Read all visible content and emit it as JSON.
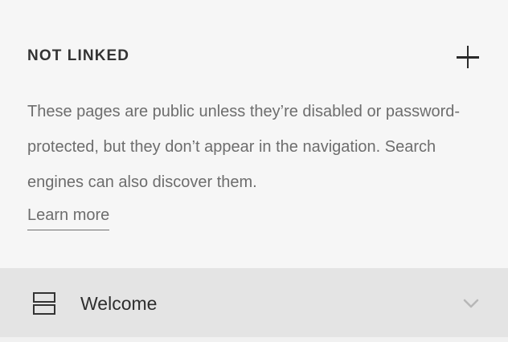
{
  "section": {
    "title": "NOT LINKED",
    "add_icon": "plus-icon",
    "description": "These pages are public unless they’re disabled or password-protected, but they don’t appear in the navigation. Search engines can also discover them.",
    "learn_more_label": "Learn more"
  },
  "pages": [
    {
      "title": "Welcome",
      "icon": "layout-page-icon",
      "expand_icon": "chevron-down-icon"
    }
  ],
  "colors": {
    "background": "#f6f6f6",
    "row_background": "#e4e4e4",
    "title_text": "#333333",
    "body_text": "#6d6d6d"
  }
}
